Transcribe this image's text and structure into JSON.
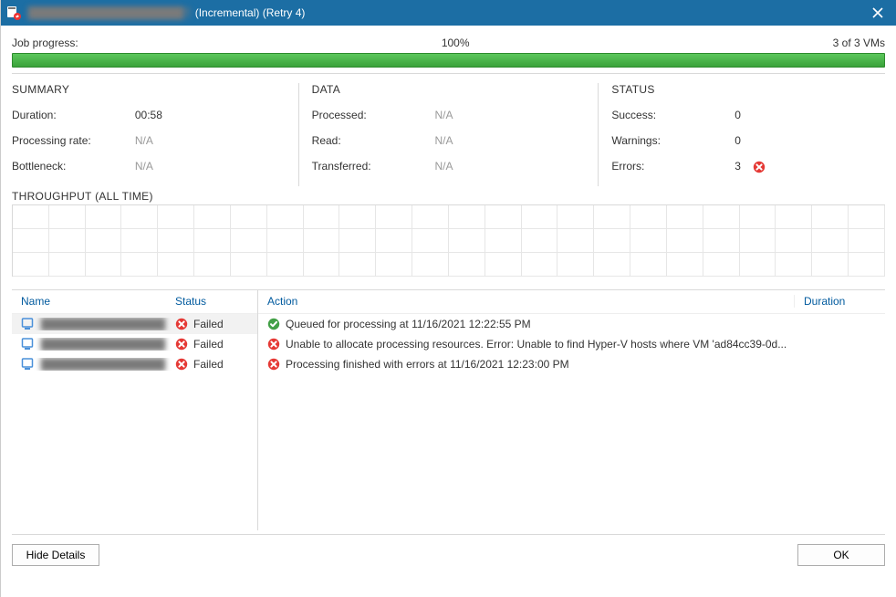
{
  "titlebar": {
    "title_obscured": "████████████████████T",
    "title_suffix": " (Incremental) (Retry 4)"
  },
  "progress": {
    "label": "Job progress:",
    "percent": "100%",
    "vm_count": "3 of 3 VMs"
  },
  "summary": {
    "heading": "SUMMARY",
    "duration_label": "Duration:",
    "duration_value": "00:58",
    "rate_label": "Processing rate:",
    "rate_value": "N/A",
    "bottleneck_label": "Bottleneck:",
    "bottleneck_value": "N/A"
  },
  "data": {
    "heading": "DATA",
    "processed_label": "Processed:",
    "processed_value": "N/A",
    "read_label": "Read:",
    "read_value": "N/A",
    "transferred_label": "Transferred:",
    "transferred_value": "N/A"
  },
  "status": {
    "heading": "STATUS",
    "success_label": "Success:",
    "success_value": "0",
    "warnings_label": "Warnings:",
    "warnings_value": "0",
    "errors_label": "Errors:",
    "errors_value": "3"
  },
  "throughput": {
    "heading": "THROUGHPUT (ALL TIME)"
  },
  "left_table": {
    "headers": {
      "name": "Name",
      "status": "Status"
    },
    "rows": [
      {
        "name": "████████████████",
        "status": "Failed"
      },
      {
        "name": "████████████████",
        "status": "Failed"
      },
      {
        "name": "████████████████",
        "status": "Failed"
      }
    ]
  },
  "right_table": {
    "headers": {
      "action": "Action",
      "duration": "Duration"
    },
    "rows": [
      {
        "icon": "ok",
        "action": "Queued for processing at 11/16/2021 12:22:55 PM",
        "duration": ""
      },
      {
        "icon": "err",
        "action": "Unable to allocate processing resources. Error: Unable to find Hyper-V hosts where VM 'ad84cc39-0d...",
        "duration": ""
      },
      {
        "icon": "err",
        "action": "Processing finished with errors at 11/16/2021 12:23:00 PM",
        "duration": ""
      }
    ]
  },
  "footer": {
    "hide": "Hide Details",
    "ok": "OK"
  },
  "icons": {
    "error": "error-icon",
    "ok": "ok-icon",
    "close": "close-icon",
    "vm": "vm-icon",
    "app": "app-icon"
  }
}
